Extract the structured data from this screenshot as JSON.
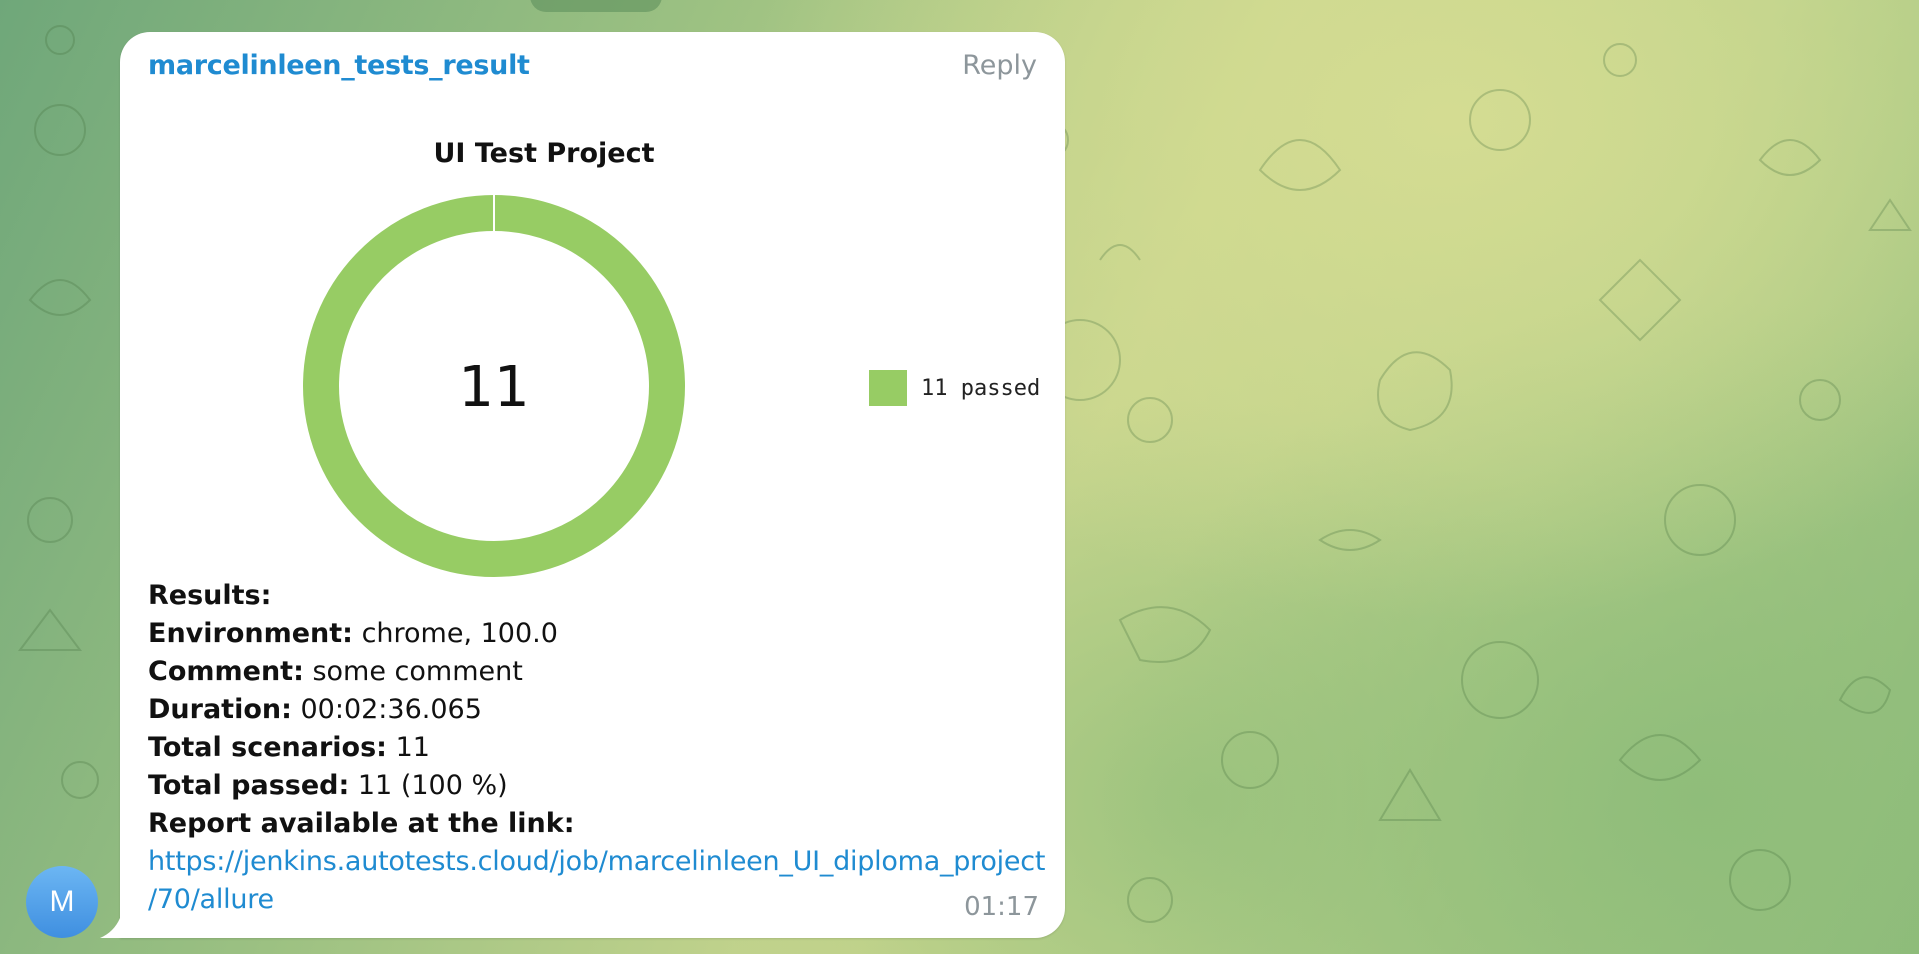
{
  "message": {
    "sender": "marcelinleen_tests_result",
    "reply_label": "Reply",
    "time": "01:17",
    "avatar_initial": "M"
  },
  "chart_data": {
    "type": "pie",
    "title": "UI Test Project",
    "center_label": "11",
    "categories": [
      "passed"
    ],
    "values": [
      11
    ],
    "legend": [
      "11 passed"
    ],
    "legend_placement": "right",
    "colors": [
      "#97cc64"
    ]
  },
  "results": {
    "heading": "Results:",
    "rows": [
      {
        "key": "Environment:",
        "value": " chrome, 100.0"
      },
      {
        "key": "Comment:",
        "value": " some comment"
      },
      {
        "key": "Duration:",
        "value": " 00:02:36.065"
      },
      {
        "key": "Total scenarios:",
        "value": " 11"
      },
      {
        "key": "Total passed:",
        "value": " 11 (100 %)"
      }
    ],
    "report_label": "Report available at the link:",
    "report_link_line1": "https://jenkins.autotests.cloud/job/marcelinleen_UI_diploma_project",
    "report_link_line2": "/70/allure"
  },
  "colors": {
    "bubble": "#ffffff",
    "link": "#1f8bd1",
    "muted": "#8d969b",
    "donut": "#97cc64"
  }
}
